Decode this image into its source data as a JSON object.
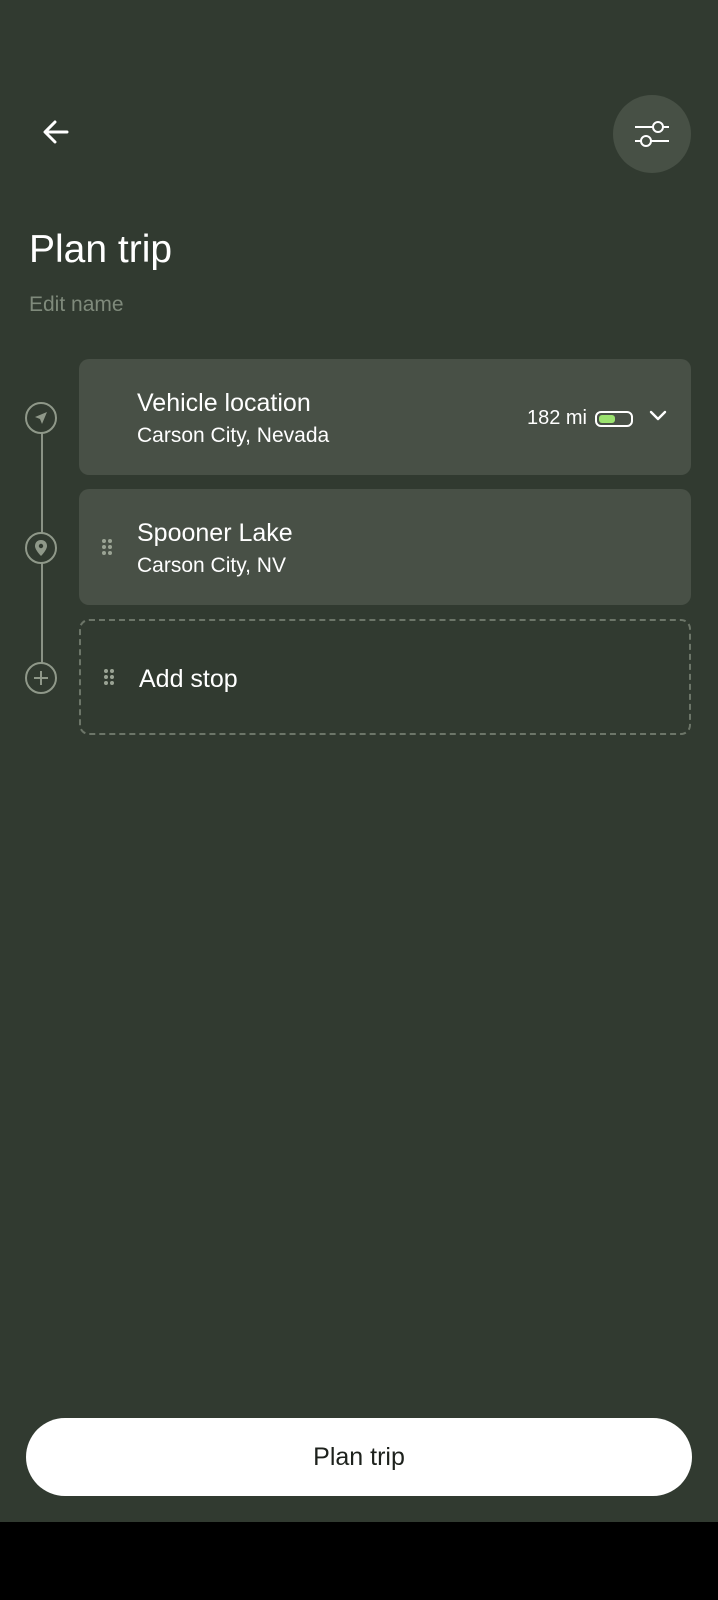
{
  "header": {
    "back_icon": "arrow-left-icon",
    "filter_icon": "sliders-icon"
  },
  "page": {
    "title": "Plan trip",
    "edit_name": "Edit name"
  },
  "stops": [
    {
      "title": "Vehicle location",
      "subtitle": "Carson City, Nevada",
      "range": "182 mi",
      "battery_level": 0.6,
      "icon": "navigation-arrow-icon"
    },
    {
      "title": "Spooner Lake",
      "subtitle": "Carson City, NV",
      "icon": "map-pin-icon"
    }
  ],
  "add_stop": {
    "label": "Add stop",
    "icon": "plus-circle-icon"
  },
  "footer": {
    "plan_button": "Plan trip"
  },
  "colors": {
    "background": "#313a30",
    "card": "#485046",
    "battery_fill": "#9be36f",
    "button": "#ffffff"
  }
}
